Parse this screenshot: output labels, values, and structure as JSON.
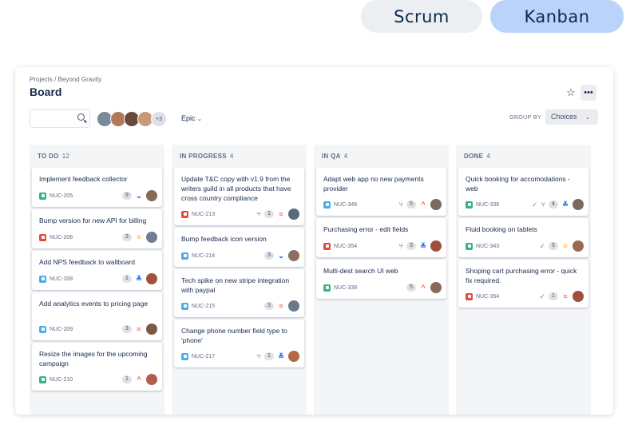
{
  "toggle": {
    "scrum": "Scrum",
    "kanban": "Kanban"
  },
  "board": {
    "breadcrumb": "Projects / Beyond Gravity",
    "title": "Board",
    "avatars_more": "+3",
    "epic_filter": "Epic",
    "group_by_label": "GROUP BY",
    "group_by_value": "Choices",
    "icons": {
      "star": "star-icon",
      "more": "more-icon",
      "search": "search-icon"
    }
  },
  "columns": [
    {
      "name": "TO DO",
      "count": "12",
      "cards": [
        {
          "title": "Implement feedback collector",
          "key": "NUC-205",
          "type": "story",
          "points": "9",
          "priority": "low"
        },
        {
          "title": "Bump version for new API for billing",
          "key": "NUC-206",
          "type": "bug",
          "points": "3",
          "priority": "medium"
        },
        {
          "title": "Add NPS feedback to wallboard",
          "key": "NUC-208",
          "type": "task",
          "points": "1",
          "priority": "lowest"
        },
        {
          "title": "Add analytics events to pricing page",
          "key": "NUC-209",
          "type": "subtask",
          "points": "3",
          "priority": "highest"
        },
        {
          "title": "Resize the images for the upcoming campaign",
          "key": "NUC-210",
          "type": "story",
          "points": "1",
          "priority": "high"
        }
      ]
    },
    {
      "name": "IN PROGRESS",
      "count": "4",
      "cards": [
        {
          "title": "Update T&C copy with v1.9 from the writers guild in all products that have cross country compliance",
          "key": "NUC-213",
          "type": "bug",
          "points": "1",
          "priority": "highest"
        },
        {
          "title": "Bump feedback icon version",
          "key": "NUC-214",
          "type": "task",
          "points": "3",
          "priority": "low"
        },
        {
          "title": "Tech spike on new stripe integration with paypal",
          "key": "NUC-215",
          "type": "task",
          "points": "3",
          "priority": "highest"
        },
        {
          "title": "Change phone number field type to 'phone'",
          "key": "NUC-217",
          "type": "task",
          "points": "1",
          "priority": "lowest"
        }
      ]
    },
    {
      "name": "IN QA",
      "count": "4",
      "cards": [
        {
          "title": "Adapt web app no new payments provider",
          "key": "NUC-346",
          "type": "subtask",
          "points": "5",
          "priority": "high"
        },
        {
          "title": "Purchasing error - edit fields",
          "key": "NUC-354",
          "type": "bug",
          "points": "3",
          "priority": "lowest"
        },
        {
          "title": "Multi-dest search UI web",
          "key": "NUC-338",
          "type": "story",
          "points": "5",
          "priority": "high"
        }
      ]
    },
    {
      "name": "DONE",
      "count": "4",
      "cards": [
        {
          "title": "Quick booking for accomodations - web",
          "key": "NUC-336",
          "type": "story",
          "points": "4",
          "priority": "lowest"
        },
        {
          "title": "Fluid booking on tablets",
          "key": "NUC-343",
          "type": "story",
          "points": "5",
          "priority": "medium"
        },
        {
          "title": "Shoping cart purchasing error - quick fix required.",
          "key": "NUC-354",
          "type": "bug",
          "points": "1",
          "priority": "highest"
        }
      ]
    }
  ],
  "colors": {
    "kanban_bg": "#b9d3fb",
    "scrum_bg": "#eceff2",
    "story": "#36b37e",
    "bug": "#e5493a",
    "task": "#4bade8"
  }
}
